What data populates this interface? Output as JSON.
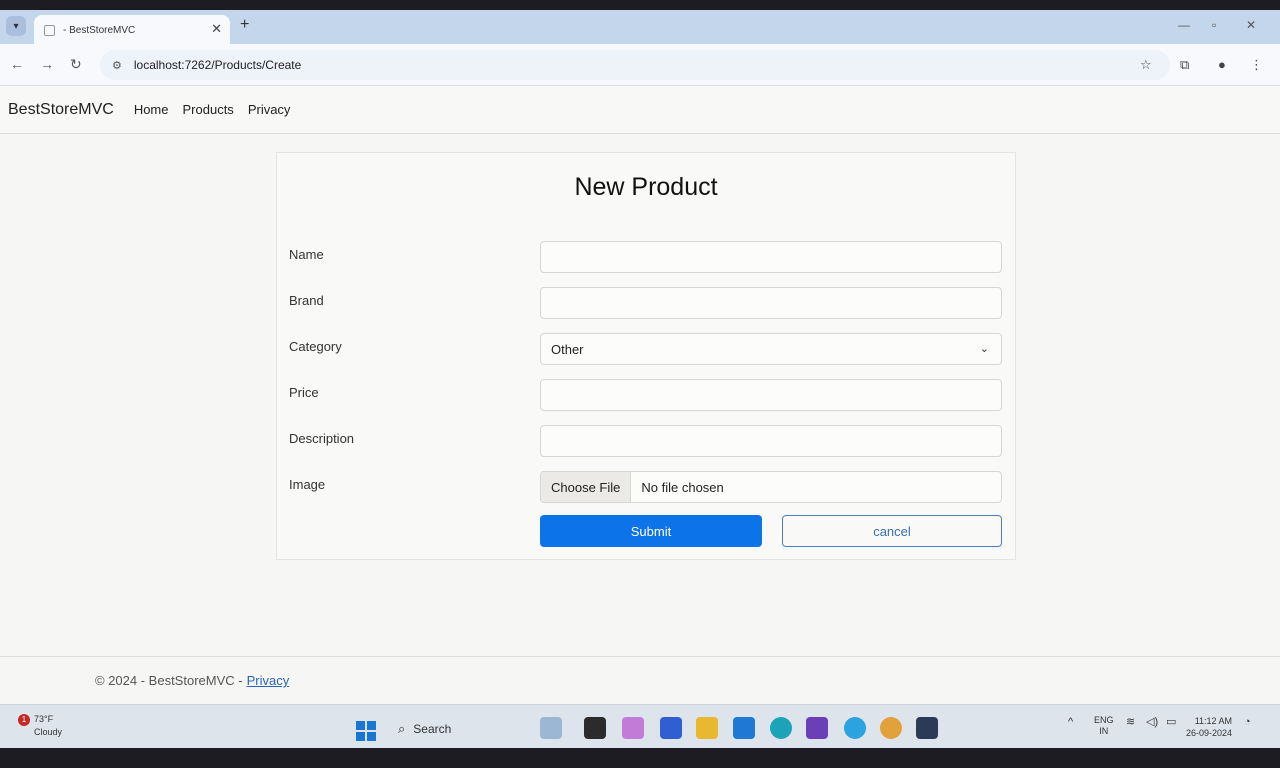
{
  "browser": {
    "tab_title": "- BestStoreMVC",
    "tab_close": "✕",
    "new_tab": "+",
    "url": "localhost:7262/Products/Create"
  },
  "site": {
    "brand": "BestStoreMVC",
    "nav": [
      {
        "label": "Home"
      },
      {
        "label": "Products"
      },
      {
        "label": "Privacy"
      }
    ]
  },
  "form": {
    "title": "New Product",
    "fields": [
      {
        "label": "Name",
        "value": ""
      },
      {
        "label": "Brand",
        "value": ""
      },
      {
        "label": "Category",
        "value": "Other"
      },
      {
        "label": "Price",
        "value": ""
      },
      {
        "label": "Description",
        "value": ""
      },
      {
        "label": "Image",
        "choose_label": "Choose File",
        "status": "No file chosen"
      }
    ],
    "submit_label": "Submit",
    "cancel_label": "cancel"
  },
  "footer": {
    "copyright": "© 2024 - BestStoreMVC -",
    "privacy_link": "Privacy"
  },
  "taskbar": {
    "weather_badge": "1",
    "weather_temp": "73°F",
    "weather_desc": "Cloudy",
    "search_label": "Search",
    "lang_top": "ENG",
    "lang_bottom": "IN",
    "time": "11:12 AM",
    "date": "26-09-2024"
  },
  "colors": {
    "primary": "#0d73e8",
    "cancel_border": "#4a7fbf",
    "link": "#2a64b8"
  }
}
